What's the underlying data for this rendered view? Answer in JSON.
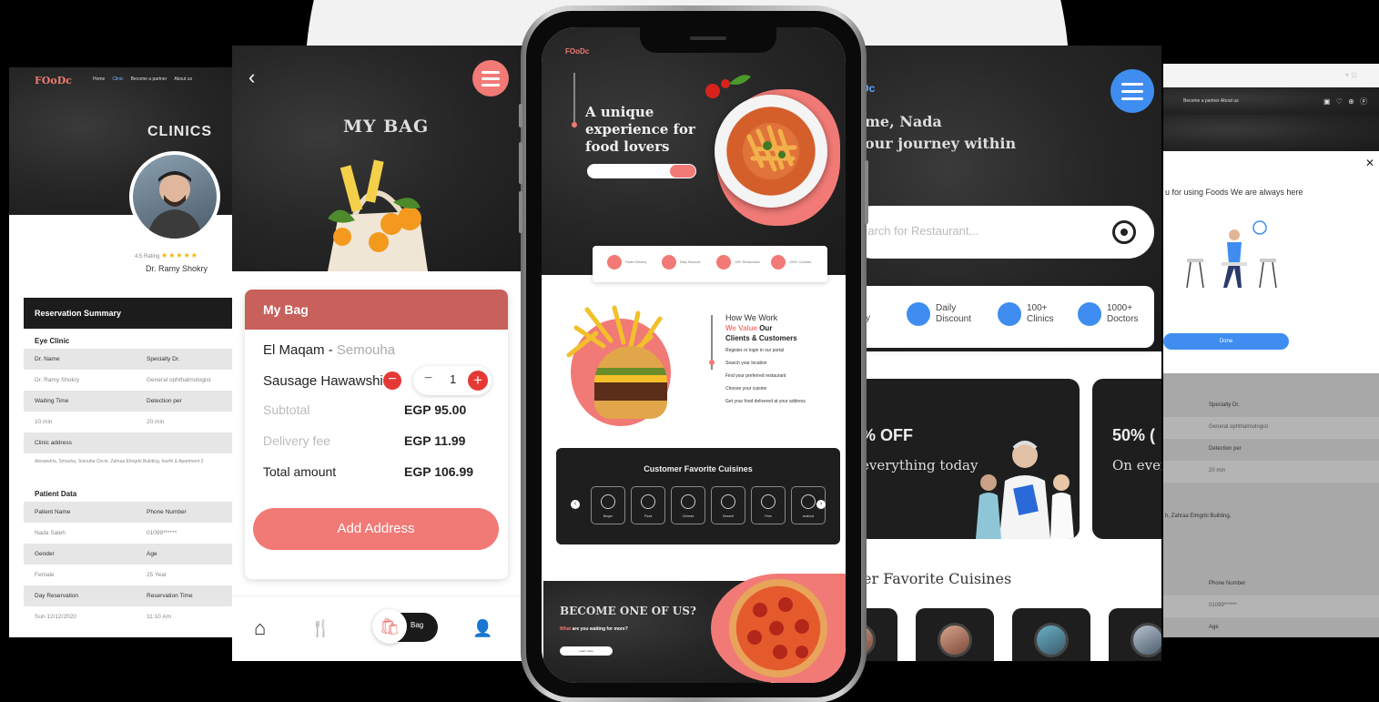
{
  "colors": {
    "accent": "#f17a76",
    "blue": "#3f8df0",
    "dark": "#1e1e1e"
  },
  "clinics": {
    "logo": "FOoDc",
    "nav": [
      "Home",
      "Clinic",
      "Become a partner",
      "About us"
    ],
    "title": "CLINICS",
    "rating": "4.5 Rating",
    "stars": "★★★★★",
    "doctor": "Dr. Ramy Shokry",
    "summary_title": "Reservation Summary",
    "eye_clinic": "Eye Clinic",
    "rows": [
      {
        "a": "Dr. Name",
        "b": "Specialty Dr."
      },
      {
        "a": "Dr. Ramy Shokry",
        "b": "General ophthalmologist"
      },
      {
        "a": "Waiting Time",
        "b": "Detection per"
      },
      {
        "a": "10 min",
        "b": "20 min"
      },
      {
        "a": "Clinic address",
        "b": ""
      }
    ],
    "address": "Alexandria, Smouha, Smouha Circle, Zahraa Elmgrbi Building, fourth & Apartment 2",
    "patient_data": "Patient Data",
    "prows": [
      {
        "a": "Patient Name",
        "b": "Phone Number"
      },
      {
        "a": "Nada Saleh",
        "b": "01099******"
      },
      {
        "a": "Gender",
        "b": "Age"
      },
      {
        "a": "Female",
        "b": "25 Year"
      },
      {
        "a": "Day Reservation",
        "b": "Reservation Time"
      },
      {
        "a": "Sun 12/12/2020",
        "b": "11:10 Am"
      }
    ]
  },
  "bag": {
    "back": "‹",
    "title": "MY BAG",
    "card_title": "My Bag",
    "restaurant": "El Maqam",
    "restaurant_sep": " - ",
    "branch": "Semouha",
    "item": "Sausage Hawawshi",
    "minus": "−",
    "step_minus": "−",
    "qty": "1",
    "step_plus": "+",
    "subtotal_label": "Subtotal",
    "subtotal": "EGP 95.00",
    "delivery_label": "Delivery fee",
    "delivery": "EGP 11.99",
    "total_label": "Total amount",
    "total": "EGP 106.99",
    "add_address": "Add Address",
    "tab_bag": "Bag",
    "tabs": {
      "home": "⌂",
      "food": "🍴",
      "bag": "🛍",
      "user": "👤"
    }
  },
  "phone": {
    "logo": "FOoDc",
    "tagline_1": "A unique",
    "tagline_2": "experience for",
    "tagline_3": "food lovers",
    "features": [
      "Faster Delivery",
      "Daily Discount",
      "100+ Restaurants",
      "1000+ Cuisines"
    ],
    "how_title": "How We Work",
    "how_value": "We Value ",
    "how_our": "Our",
    "how_clients": "Clients & Customers",
    "steps": [
      "Register or login in our portal",
      "Search your location",
      "Find your preferred restaurant",
      "Choose your cuisine",
      "Get your food delivered at your address"
    ],
    "cuisines_title": "Customer Favorite Cuisines",
    "cuisines": [
      "Burger",
      "Pizza",
      "Chinese",
      "Dessert",
      "Fries",
      "seafood"
    ],
    "prev": "‹",
    "next": "›",
    "join_title": "BECOME ONE OF US?",
    "join_sub_a": "What",
    "join_sub_b": " are you waiting for more?",
    "join_btn": "Learn more"
  },
  "home": {
    "logo": "Dc",
    "greet_1": "me, Nada",
    "greet_2": "our journey within",
    "search_placeholder": "earch for Restaurant...",
    "features": [
      {
        "l1": "ook",
        "l2": "asily"
      },
      {
        "l1": "Daily",
        "l2": "Discount"
      },
      {
        "l1": "100+",
        "l2": "Clinics"
      },
      {
        "l1": "1000+",
        "l2": "Doctors"
      }
    ],
    "promo1_pct": "% OFF",
    "promo1_sub": "everything today",
    "promo2_pct": "50% (",
    "promo2_sub": "On ever",
    "cuisines_title": "er Favorite Cuisines"
  },
  "popup": {
    "status": "▾ ⊡",
    "nav": "Become a partner    About us",
    "icons": "▣ ♡ ⊕ ⓟ",
    "close": "✕",
    "message": "u for using Foods We are always here",
    "done": "Done",
    "rows": [
      {
        "t": "Specialty Dr.",
        "g": false
      },
      {
        "t": "General ophthalmologist",
        "g": true
      },
      {
        "t": "Detection per",
        "g": false
      },
      {
        "t": "20 min",
        "g": true
      },
      {
        "t": "",
        "g": false
      },
      {
        "t": "h, Zahraa Elmgrbi Building,",
        "g": false
      },
      {
        "t": "",
        "g": false
      },
      {
        "t": "Phone Number",
        "g": false
      },
      {
        "t": "01099******",
        "g": true
      },
      {
        "t": "Age",
        "g": false
      }
    ]
  }
}
